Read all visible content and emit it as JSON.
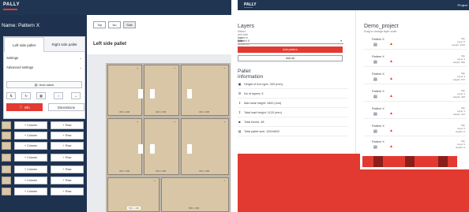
{
  "colors": {
    "navy": "#1f3552",
    "red": "#e23a30",
    "box": "#d8c6a6",
    "pallet": "#bdb7ad"
  },
  "left_app": {
    "logo": "PALLY",
    "name_label": "Name:",
    "name_value": "Pattern X",
    "tabs": [
      "Left side pallet",
      "Right side pallet"
    ],
    "menu": [
      "Settings",
      "Advanced settings"
    ],
    "auto_stack": "Auto stack",
    "icon_buttons": [
      "swap-icon",
      "rotate-icon",
      "grid-icon",
      "split-vertical-icon",
      "split-horizontal-icon"
    ],
    "info_button": "Info",
    "dimensions_button": "Dimensions",
    "row_buttons": {
      "column": "Column",
      "row": "Row"
    },
    "view_buttons": [
      "Top",
      "Iso",
      "Side"
    ],
    "editor_title": "Left side pallet",
    "box_labels": [
      "333 x 400",
      "333 x 400",
      "333 x 400",
      "333 x 400",
      "333 x 400",
      "333 x 400",
      "500 x 400",
      "500 x 400"
    ]
  },
  "right_app": {
    "logo": "PALLY",
    "nav": "Project",
    "layers_title": "Layers",
    "layers_subtitle": "Select and add layers to your sequence",
    "select_label": "Layer type",
    "select_value": "Pattern X",
    "add_pattern_button": "Add pattern",
    "add_all_button": "Add all",
    "pallet_info_title": "Pallet information",
    "pallet_info": [
      {
        "icon": "box-icon",
        "text": "Height of box type: 333 (mm)"
      },
      {
        "icon": "layers-icon",
        "text": "No of layers: 5"
      },
      {
        "icon": "height-icon",
        "text": "Max total height: 1800 (mm)"
      },
      {
        "icon": "height-icon",
        "text": "Total load height: 1120 (mm)"
      },
      {
        "icon": "weight-icon",
        "text": "Total boxes: 48"
      },
      {
        "icon": "stack-icon",
        "text": "Total pallet size: 1200x800"
      }
    ],
    "project_title": "Demo_project",
    "project_subtitle": "Drag to change layer order",
    "layer_items": [
      {
        "name": "Pattern X",
        "meta": [
          "Slip",
          "Layer 5",
          "Height: 1120"
        ]
      },
      {
        "name": "Pattern X",
        "meta": [
          "Slip",
          "Layer 4",
          "Height: 896"
        ]
      },
      {
        "name": "Pattern X",
        "meta": [
          "Slip",
          "Layer 3",
          "Height: 672"
        ]
      },
      {
        "name": "Pattern X",
        "meta": [
          "Slip",
          "Layer 2",
          "Height: 448"
        ]
      },
      {
        "name": "Pattern X",
        "meta": [
          "Slip",
          "Layer 1",
          "Height: 224"
        ]
      },
      {
        "name": "Pattern X",
        "meta": [
          "Slip",
          "Layer 0",
          "Height: 0"
        ]
      },
      {
        "name": "Pattern X",
        "meta": [
          "Slip",
          "Layer 0",
          "Height: 0"
        ]
      }
    ]
  }
}
